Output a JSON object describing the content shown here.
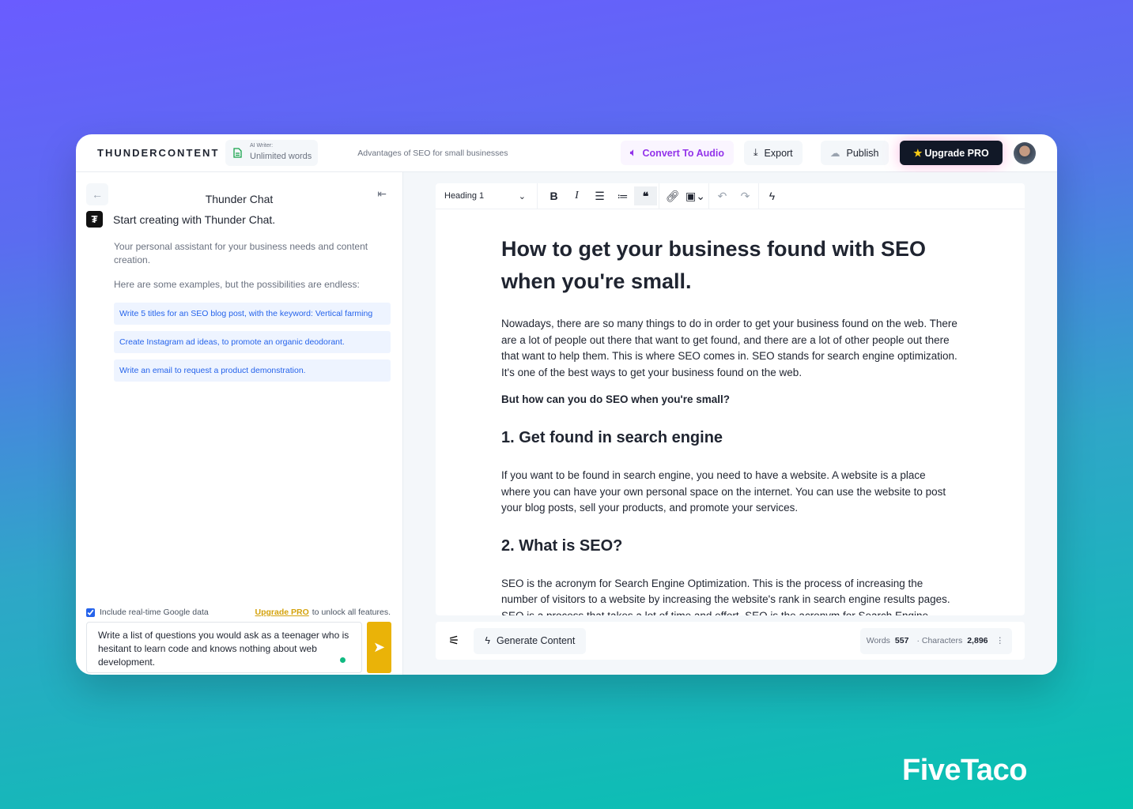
{
  "header": {
    "logo": "THUNDERCONTENT",
    "ai_writer_label": "AI Writer:",
    "ai_writer_value": "Unlimited words",
    "document_title": "Advantages of SEO for small businesses",
    "convert_audio": "Convert To Audio",
    "export": "Export",
    "publish": "Publish",
    "upgrade": "Upgrade PRO"
  },
  "chat": {
    "title": "Thunder Chat",
    "start": "Start creating with Thunder Chat.",
    "intro": "Your personal assistant for your business needs and content creation.",
    "examples_intro": "Here are some examples, but the possibilities are endless:",
    "examples": [
      "Write 5 titles for an SEO blog post, with the keyword: Vertical farming",
      "Create Instagram ad ideas, to promote an organic deodorant.",
      "Write an email to request a product demonstration."
    ],
    "google_label": "Include real-time Google data",
    "google_checked": true,
    "upgrade_link": "Upgrade PRO",
    "upgrade_suffix": " to unlock all features.",
    "prompt": "Write a list of questions you would ask as a teenager who is hesitant to learn code and knows nothing about web development."
  },
  "toolbar": {
    "block_type": "Heading 1"
  },
  "editor": {
    "title": "How to get your business found with SEO when you're small.",
    "p1": "Nowadays, there are so many things to do in order to get your business found on the web. There are a lot of people out there that want to get found, and there are a lot of other people out there that want to help them. This is where SEO comes in. SEO stands for search engine optimization. It's one of the best ways to get your business found on the web.",
    "p2": "But how can you do SEO when you're small?",
    "h2a": "1. Get found in search engine",
    "p3": " If you want to be found in search engine, you need to have a website. A website is a place where you can have your own personal space on the internet. You can use the website to post your blog posts, sell your products, and promote your services.",
    "h2b": "2. What is SEO?",
    "p4": " SEO is the acronym for Search Engine Optimization. This is the process of increasing the number of visitors to a website by increasing the website's rank in search engine results pages. SEO is a process that takes a lot of time and effort. SEO is the acronym for Search Engine Optimization. This is the process of getting your website to the top of the search engine results."
  },
  "footer": {
    "generate": "Generate Content",
    "words_label": "Words",
    "words": "557",
    "chars_label": "· Characters",
    "chars": "2,896"
  },
  "brand": "FiveTaco",
  "colors": {
    "accent_purple": "#9333ea",
    "upgrade_bg": "#111827",
    "send_button": "#eab308",
    "link_blue": "#2563eb"
  }
}
